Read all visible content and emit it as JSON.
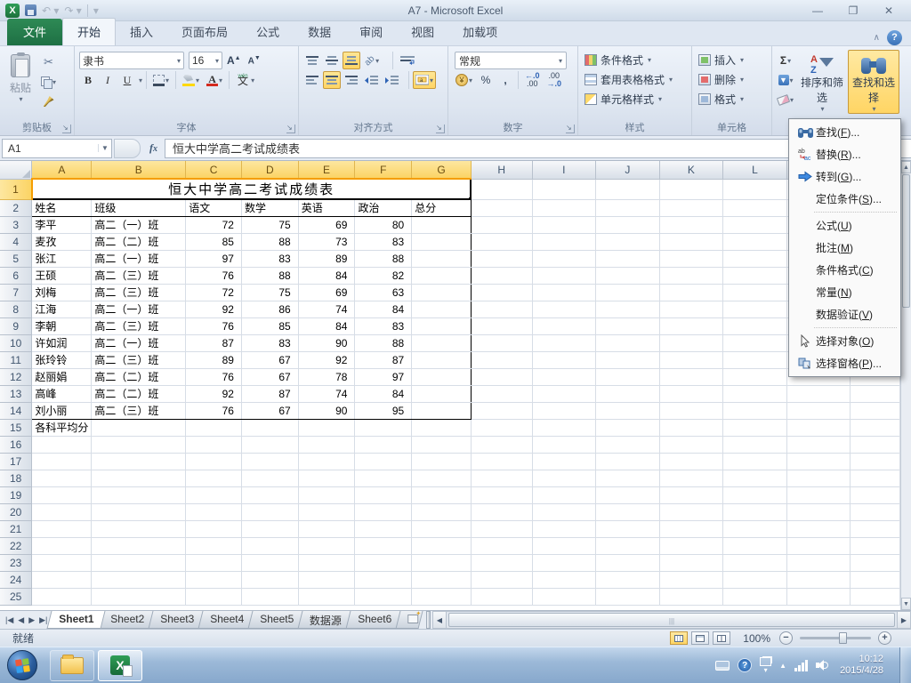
{
  "window": {
    "title": "A7 - Microsoft Excel"
  },
  "ribbon": {
    "tabs": [
      {
        "label": "文件",
        "type": "file"
      },
      {
        "label": "开始",
        "active": true
      },
      {
        "label": "插入"
      },
      {
        "label": "页面布局"
      },
      {
        "label": "公式"
      },
      {
        "label": "数据"
      },
      {
        "label": "审阅"
      },
      {
        "label": "视图"
      },
      {
        "label": "加载项"
      }
    ],
    "clipboard": {
      "label": "剪贴板",
      "paste_label": "粘贴"
    },
    "font": {
      "label": "字体",
      "name": "隶书",
      "size": "16",
      "phonetic": "文"
    },
    "alignment": {
      "label": "对齐方式"
    },
    "number": {
      "label": "数字",
      "format": "常规"
    },
    "styles": {
      "label": "样式",
      "buttons": [
        "条件格式",
        "套用表格格式",
        "单元格样式"
      ]
    },
    "cells": {
      "label": "单元格",
      "buttons": [
        "插入",
        "删除",
        "格式"
      ]
    },
    "editing": {
      "sigma": "Σ",
      "sort_label": "排序和筛选",
      "find_label": "查找和选择"
    }
  },
  "formula_bar": {
    "name_box": "A1",
    "formula": "恒大中学高二考试成绩表"
  },
  "grid": {
    "columns": [
      "A",
      "B",
      "C",
      "D",
      "E",
      "F",
      "G",
      "H",
      "I",
      "J",
      "K",
      "L"
    ],
    "selected_column_count": 7,
    "row_count": 25,
    "title": "恒大中学高二考试成绩表",
    "headers": [
      "姓名",
      "班级",
      "语文",
      "数学",
      "英语",
      "政治",
      "总分"
    ],
    "students": [
      {
        "name": "李平",
        "cls": "高二（一）班",
        "scores": [
          72,
          75,
          69,
          80
        ]
      },
      {
        "name": "麦孜",
        "cls": "高二（二）班",
        "scores": [
          85,
          88,
          73,
          83
        ]
      },
      {
        "name": "张江",
        "cls": "高二（一）班",
        "scores": [
          97,
          83,
          89,
          88
        ]
      },
      {
        "name": "王硕",
        "cls": "高二（三）班",
        "scores": [
          76,
          88,
          84,
          82
        ]
      },
      {
        "name": "刘梅",
        "cls": "高二（三）班",
        "scores": [
          72,
          75,
          69,
          63
        ]
      },
      {
        "name": "江海",
        "cls": "高二（一）班",
        "scores": [
          92,
          86,
          74,
          84
        ]
      },
      {
        "name": "李朝",
        "cls": "高二（三）班",
        "scores": [
          76,
          85,
          84,
          83
        ]
      },
      {
        "name": "许如润",
        "cls": "高二（一）班",
        "scores": [
          87,
          83,
          90,
          88
        ]
      },
      {
        "name": "张玲铃",
        "cls": "高二（三）班",
        "scores": [
          89,
          67,
          92,
          87
        ]
      },
      {
        "name": "赵丽娟",
        "cls": "高二（二）班",
        "scores": [
          76,
          67,
          78,
          97
        ]
      },
      {
        "name": "高峰",
        "cls": "高二（二）班",
        "scores": [
          92,
          87,
          74,
          84
        ]
      },
      {
        "name": "刘小丽",
        "cls": "高二（三）班",
        "scores": [
          76,
          67,
          90,
          95
        ]
      }
    ],
    "footer": "各科平均分"
  },
  "find_menu": {
    "items": [
      {
        "icon": "binoculars-icon",
        "label": "查找",
        "key": "F",
        "dots": "..."
      },
      {
        "icon": "replace-icon",
        "label": "替换",
        "key": "R",
        "dots": "..."
      },
      {
        "icon": "goto-arrow-icon",
        "label": "转到",
        "key": "G",
        "dots": "..."
      },
      {
        "label": "定位条件",
        "key": "S",
        "dots": "..."
      },
      {
        "separator": true
      },
      {
        "label": "公式",
        "key": "U"
      },
      {
        "label": "批注",
        "key": "M"
      },
      {
        "label": "条件格式",
        "key": "C"
      },
      {
        "label": "常量",
        "key": "N"
      },
      {
        "label": "数据验证",
        "key": "V"
      },
      {
        "separator": true
      },
      {
        "icon": "select-cursor-icon",
        "label": "选择对象",
        "key": "O"
      },
      {
        "icon": "selection-pane-icon",
        "label": "选择窗格",
        "key": "P",
        "dots": "..."
      }
    ]
  },
  "sheet_tabs": [
    {
      "label": "Sheet1",
      "active": true
    },
    {
      "label": "Sheet2"
    },
    {
      "label": "Sheet3"
    },
    {
      "label": "Sheet4"
    },
    {
      "label": "Sheet5"
    },
    {
      "label": "数据源"
    },
    {
      "label": "Sheet6"
    }
  ],
  "status_bar": {
    "mode": "就绪",
    "zoom_level": "100%"
  },
  "taskbar": {
    "time": "10:12",
    "date": "2015/4/28"
  },
  "colors": {
    "accent_gold": "#ffd564",
    "file_tab_green": "#1e7044",
    "selection_border": "#000000"
  }
}
